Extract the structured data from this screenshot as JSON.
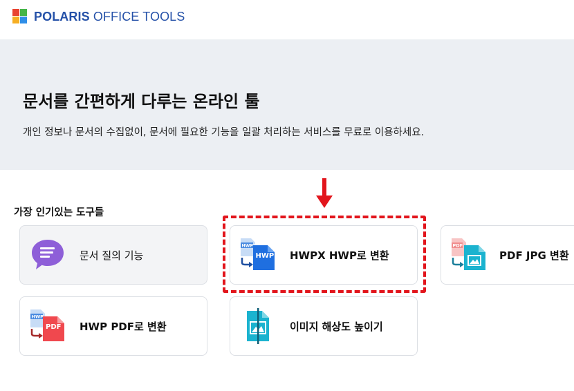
{
  "header": {
    "logo_bold": "POLARIS",
    "logo_light": " OFFICE TOOLS",
    "logo_colors": [
      "#e94330",
      "#44b549",
      "#f6ae22",
      "#2e8ee8"
    ]
  },
  "hero": {
    "title": "문서를 간편하게 다루는 온라인 툴",
    "subtitle": "개인 정보나 문서의 수집없이, 문서에 필요한 기능을 일괄 처리하는 서비스를 무료로 이용하세요."
  },
  "popular": {
    "title": "가장 인기있는 도구들",
    "tools": [
      {
        "label": "문서 질의 기능",
        "icon": "chat-bubble-icon"
      },
      {
        "label": "HWPX HWP로 변환",
        "icon": "hwpx-to-hwp-icon",
        "src_badge": "HWPX",
        "dst_badge": "HWP"
      },
      {
        "label": "PDF JPG 변환",
        "icon": "pdf-to-jpg-icon",
        "src_badge": "PDF"
      },
      {
        "label": "HWP PDF로 변환",
        "icon": "hwp-to-pdf-icon",
        "src_badge": "HWP",
        "dst_badge": "PDF"
      },
      {
        "label": "이미지 해상도 높이기",
        "icon": "image-upscale-icon"
      }
    ]
  },
  "annotation": {
    "arrow_color": "#e2151c",
    "highlight_color": "#e2151c"
  }
}
